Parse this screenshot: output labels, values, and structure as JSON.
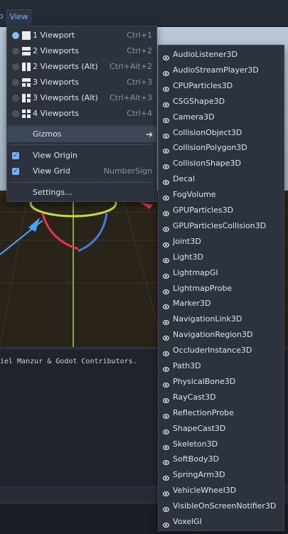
{
  "topbar": {
    "cutoff_text": "o",
    "view_label": "View"
  },
  "menu": {
    "items": [
      {
        "label": "1 Viewport",
        "shortcut": "Ctrl+1"
      },
      {
        "label": "2 Viewports",
        "shortcut": "Ctrl+2"
      },
      {
        "label": "2 Viewports (Alt)",
        "shortcut": "Ctrl+Alt+2"
      },
      {
        "label": "3 Viewports",
        "shortcut": "Ctrl+3"
      },
      {
        "label": "3 Viewports (Alt)",
        "shortcut": "Ctrl+Alt+3"
      },
      {
        "label": "4 Viewports",
        "shortcut": "Ctrl+4"
      }
    ],
    "gizmos_label": "Gizmos",
    "view_origin_label": "View Origin",
    "view_grid_label": "View Grid",
    "view_grid_shortcut": "NumberSign",
    "settings_label": "Settings..."
  },
  "output": {
    "line": "riel Manzur & Godot Contributors."
  },
  "gizmos": [
    "AudioListener3D",
    "AudioStreamPlayer3D",
    "CPUParticles3D",
    "CSGShape3D",
    "Camera3D",
    "CollisionObject3D",
    "CollisionPolygon3D",
    "CollisionShape3D",
    "Decal",
    "FogVolume",
    "GPUParticles3D",
    "GPUParticlesCollision3D",
    "Joint3D",
    "Light3D",
    "LightmapGI",
    "LightmapProbe",
    "Marker3D",
    "NavigationLink3D",
    "NavigationRegion3D",
    "OccluderInstance3D",
    "Path3D",
    "PhysicalBone3D",
    "RayCast3D",
    "ReflectionProbe",
    "ShapeCast3D",
    "Skeleton3D",
    "SoftBody3D",
    "SpringArm3D",
    "VehicleWheel3D",
    "VisibleOnScreenNotifier3D",
    "VoxelGI"
  ]
}
